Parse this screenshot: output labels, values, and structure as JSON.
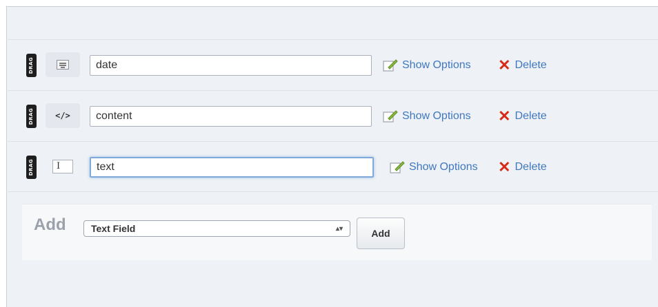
{
  "fields": [
    {
      "drag_label": "DRAG",
      "type_icon": "date-picker-icon",
      "value": "date",
      "options_label": "Show Options",
      "delete_label": "Delete"
    },
    {
      "drag_label": "DRAG",
      "type_icon": "code-icon",
      "type_glyph": "</>",
      "value": "content",
      "options_label": "Show Options",
      "delete_label": "Delete"
    },
    {
      "drag_label": "DRAG",
      "type_icon": "text-field-icon",
      "type_glyph": "I",
      "value": "text",
      "options_label": "Show Options",
      "delete_label": "Delete"
    }
  ],
  "add_section": {
    "label": "Add",
    "select_value": "Text Field",
    "button_label": "Add"
  },
  "colors": {
    "link": "#3f78c0",
    "delete_x": "#d62a16",
    "panel_bg": "#eef1f5"
  }
}
